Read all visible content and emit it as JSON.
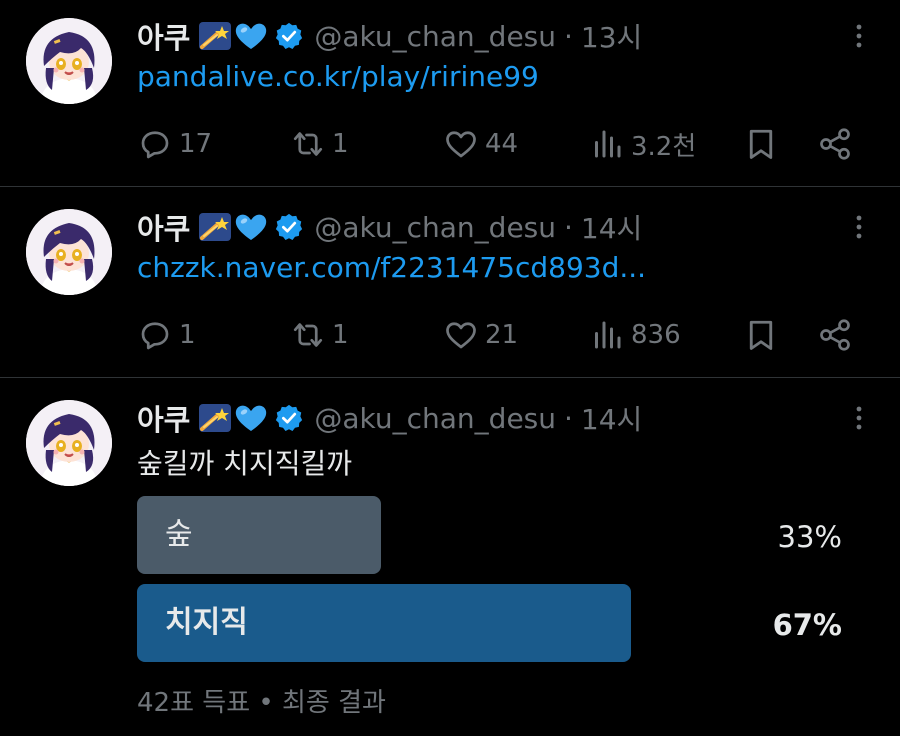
{
  "tweets": [
    {
      "author_name": "아쿠",
      "handle": "@aku_chan_desu",
      "separator": "·",
      "time": "13시",
      "link_text": "pandalive.co.kr/play/ririne99",
      "stats": {
        "replies": "17",
        "retweets": "1",
        "likes": "44",
        "views": "3.2천"
      }
    },
    {
      "author_name": "아쿠",
      "handle": "@aku_chan_desu",
      "separator": "·",
      "time": "14시",
      "link_text": "chzzk.naver.com/f2231475cd893d...",
      "stats": {
        "replies": "1",
        "retweets": "1",
        "likes": "21",
        "views": "836"
      }
    },
    {
      "author_name": "아쿠",
      "handle": "@aku_chan_desu",
      "separator": "·",
      "time": "14시",
      "text": "숲킬까 치지직킬까",
      "poll": {
        "options": [
          {
            "label": "숲",
            "percent_text": "33%",
            "percent": 33,
            "color": "#4b5b69"
          },
          {
            "label": "치지직",
            "percent_text": "67%",
            "percent": 67,
            "color": "#1a5b8c"
          }
        ],
        "footer": "42표 득표 • 최종 결과"
      }
    }
  ],
  "colors": {
    "link": "#1d9bf0",
    "muted": "#71767b",
    "verified": "#1d9bf0",
    "background": "#000000"
  },
  "icons": [
    "reply-icon",
    "retweet-icon",
    "like-icon",
    "views-icon",
    "bookmark-icon",
    "share-icon",
    "more-icon",
    "verified-badge-icon",
    "shooting-star-emoji",
    "blue-heart-emoji"
  ]
}
